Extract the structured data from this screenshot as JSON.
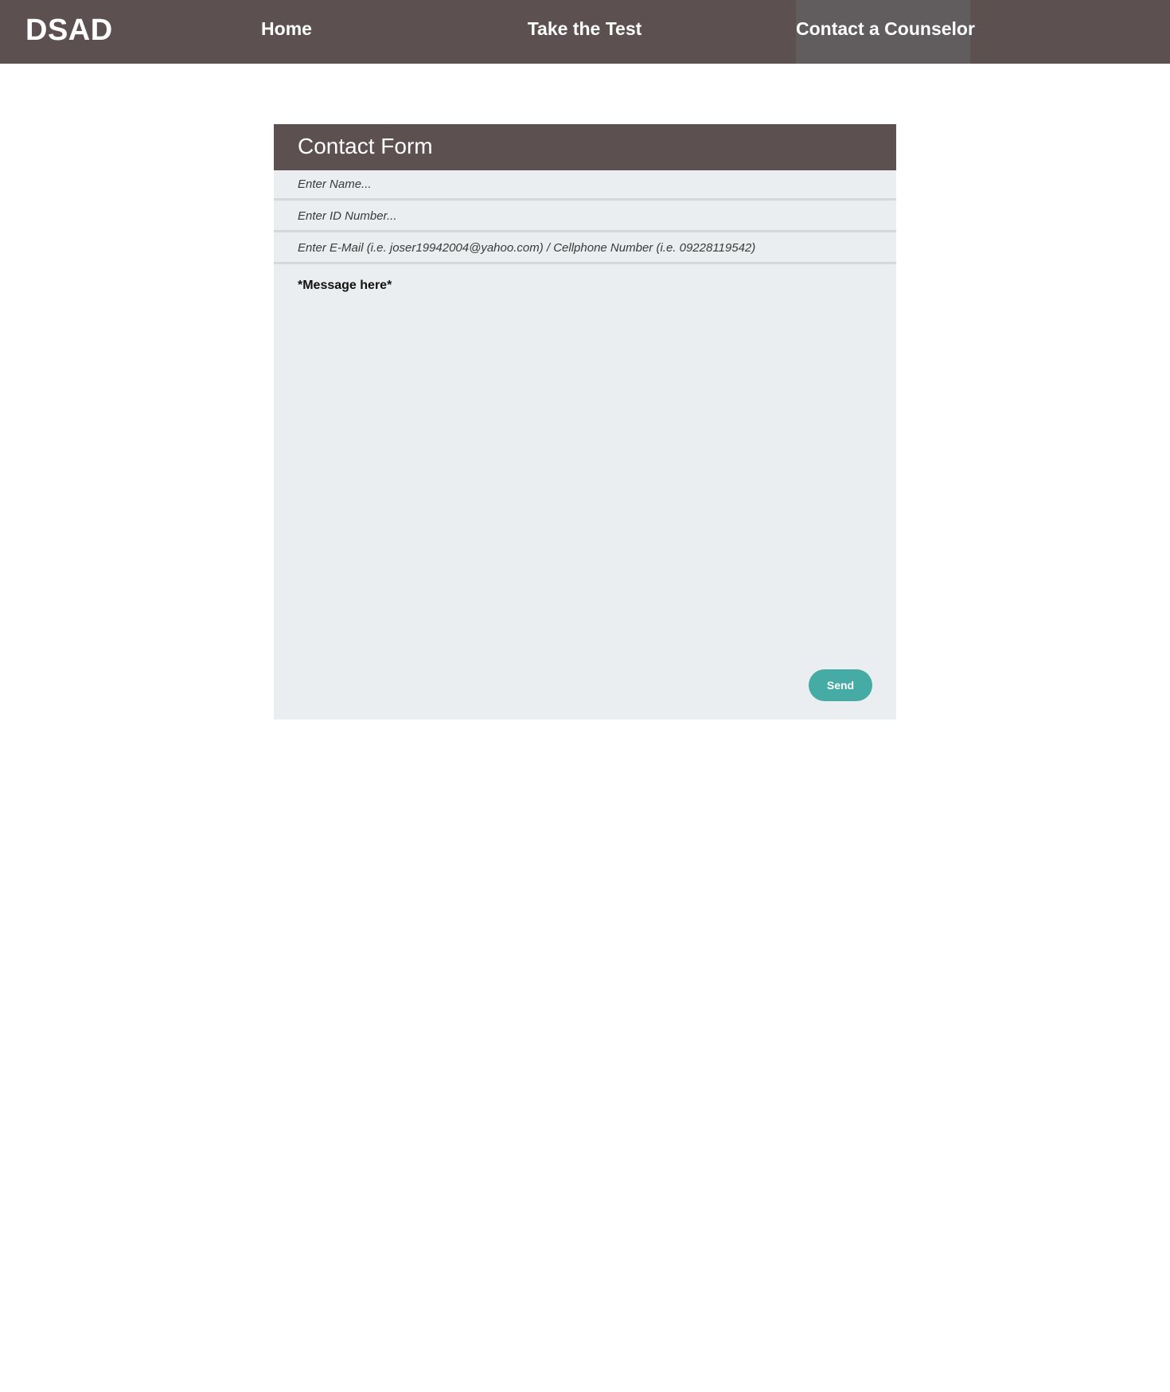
{
  "nav": {
    "logo": "DSAD",
    "items": [
      {
        "label": "Home",
        "active": false
      },
      {
        "label": "Take the Test",
        "active": false
      },
      {
        "label": "Contact a Counselor",
        "active": true
      }
    ]
  },
  "form": {
    "title": "Contact Form",
    "name_placeholder": "Enter Name...",
    "id_placeholder": "Enter ID Number...",
    "contact_placeholder": "Enter E-Mail (i.e. joser19942004@yahoo.com) / Cellphone Number (i.e. 09228119542)",
    "message_value": "*Message here*",
    "send_label": "Send"
  },
  "colors": {
    "nav_bg": "#5c5150",
    "nav_active_bg": "#615c5e",
    "form_bg": "#ebeef0",
    "field_border": "#d5d8da",
    "accent": "#46aaa5"
  }
}
